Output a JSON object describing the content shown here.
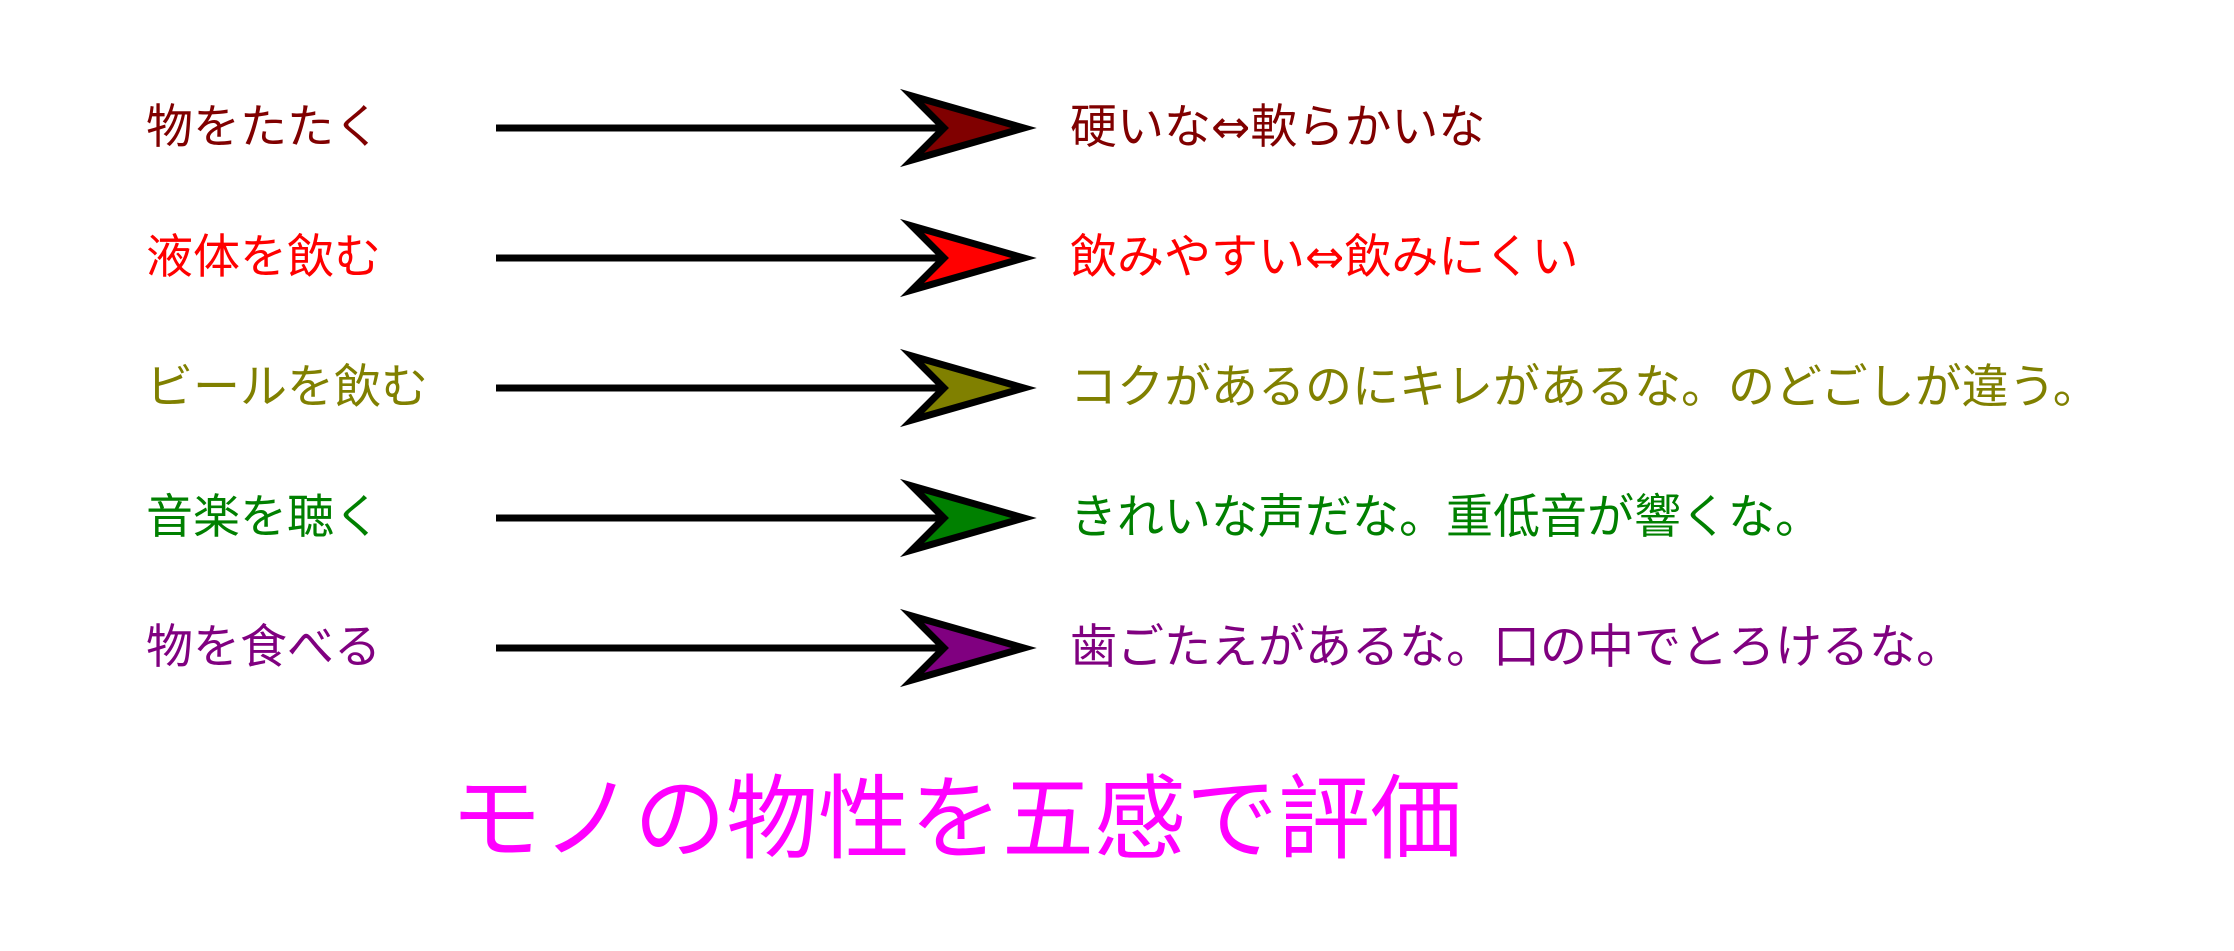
{
  "title": {
    "text": "モノの物性を五感で評価",
    "color": "#ff00ff"
  },
  "rows": [
    {
      "action": "物をたたく",
      "result": "硬いな⇔軟らかいな",
      "color": "#800000"
    },
    {
      "action": "液体を飲む",
      "result": "飲みやすい⇔飲みにくい",
      "color": "#ff0000"
    },
    {
      "action": "ビールを飲む",
      "result": "コクがあるのにキレがあるな。のどごしが違う。",
      "color": "#808000"
    },
    {
      "action": "音楽を聴く",
      "result": "きれいな声だな。重低音が響くな。",
      "color": "#008000"
    },
    {
      "action": "物を食べる",
      "result": "歯ごたえがあるな。口の中でとろけるな。",
      "color": "#800080"
    }
  ],
  "arrow": {
    "shaft_color": "#000000",
    "outline_color": "#000000"
  }
}
